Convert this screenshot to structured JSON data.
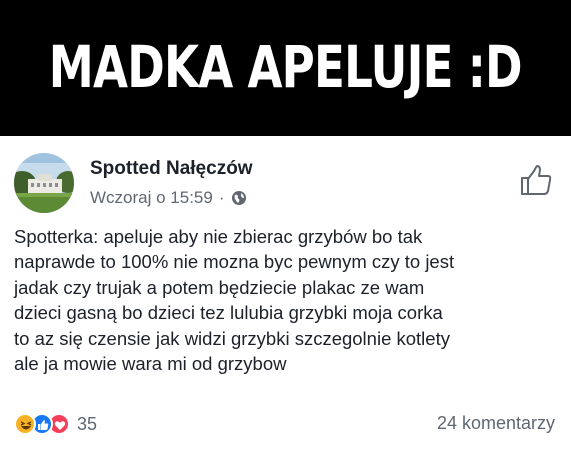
{
  "banner": {
    "title": "MADKA APELUJE :D"
  },
  "post": {
    "page_name": "Spotted Nałęczów",
    "timestamp": "Wczoraj o 15:59",
    "separator": "·",
    "lines": [
      "Spotterka: apeluje aby nie zbierac grzybów bo tak",
      "naprawde to 100% nie mozna byc pewnym czy to jest",
      "jadak czy trujak a potem będziecie plakac ze wam",
      "dzieci gasną bo dzieci tez lulubia grzybki moja corka",
      "to az się czensie jak widzi grzybki szczegolnie kotlety",
      "ale ja mowie wara mi od grzybow"
    ],
    "reaction_count": "35",
    "comments_label": "24 komentarzy",
    "reaction_icons": [
      "haha-icon",
      "like-icon",
      "love-icon"
    ]
  },
  "colors": {
    "banner_bg": "#000000",
    "like_blue": "#1877f2",
    "love_red": "#f33e58",
    "haha_yellow": "#f7b125",
    "meta_gray": "#606770"
  }
}
